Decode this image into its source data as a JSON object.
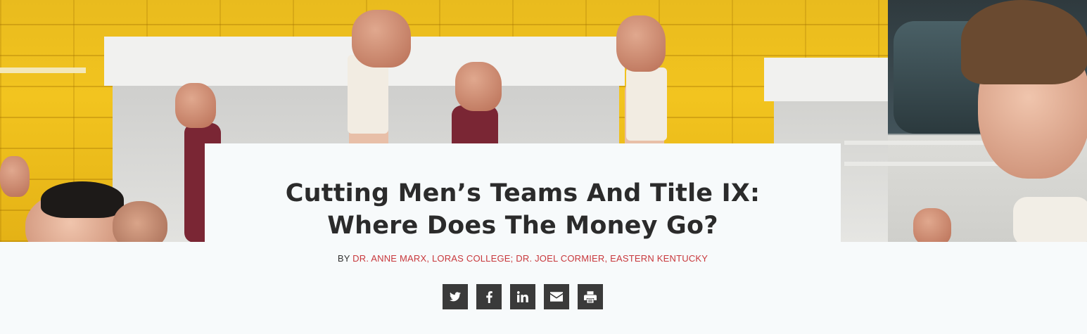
{
  "article": {
    "title_line1": "Cutting Men’s Teams And Title IX:",
    "title_line2": "Where Does The Money Go?",
    "byline_prefix": "BY ",
    "authors": "DR. ANNE MARX, LORAS COLLEGE; DR. JOEL CORMIER, EASTERN KENTUCKY",
    "accent_color": "#c8383c"
  },
  "hero_image": {
    "description_icon": "hero-photo"
  },
  "share": {
    "buttons": [
      {
        "icon": "twitter-icon"
      },
      {
        "icon": "facebook-icon"
      },
      {
        "icon": "linkedin-icon"
      },
      {
        "icon": "email-icon"
      },
      {
        "icon": "print-icon"
      }
    ],
    "button_color": "#3a3a3a"
  }
}
